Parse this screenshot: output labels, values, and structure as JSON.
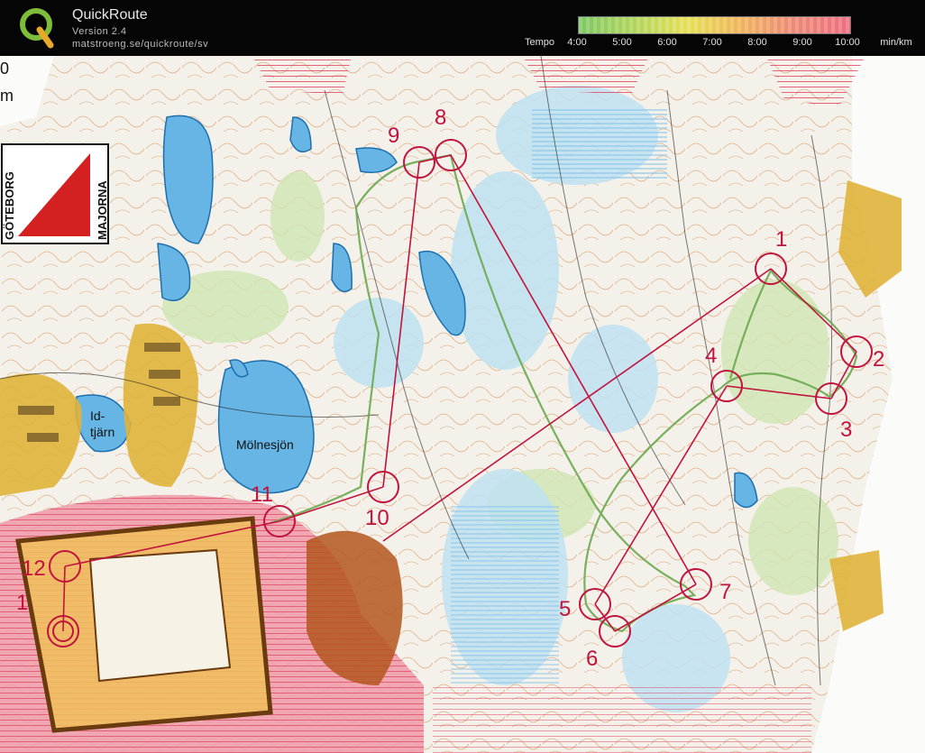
{
  "app": {
    "name": "QuickRoute",
    "version": "Version 2.4",
    "url": "matstroeng.se/quickroute/sv"
  },
  "pace_legend": {
    "label": "Tempo",
    "ticks": [
      "4:00",
      "5:00",
      "6:00",
      "7:00",
      "8:00",
      "9:00",
      "10:00"
    ],
    "unit": "min/km"
  },
  "map": {
    "lake_label": "Mölnesjön",
    "pond_label": "Id-\ntjärn",
    "club_logo": [
      "GÖTEBORG",
      "MAJORNA"
    ],
    "edge_text": [
      "0",
      "m"
    ],
    "controls": [
      "1",
      "2",
      "3",
      "4",
      "5",
      "6",
      "7",
      "8",
      "9",
      "10",
      "11",
      "12",
      "1"
    ],
    "colors": {
      "water": "#66b5e4",
      "course": "#c0133d",
      "track": "#6aa84f",
      "urban": "#d9a528",
      "restricted": "#e87a8c"
    }
  }
}
